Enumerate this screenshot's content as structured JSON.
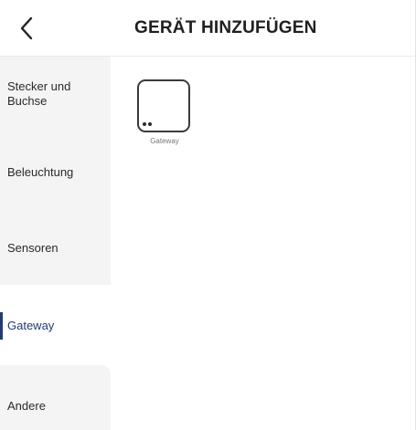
{
  "header": {
    "back_icon": "chevron-left-icon",
    "title": "GERÄT HINZUFÜGEN"
  },
  "sidebar": {
    "items": [
      {
        "label": "Stecker und\nBuchse",
        "active": false
      },
      {
        "label": "Beleuchtung",
        "active": false
      },
      {
        "label": "Sensoren",
        "active": false
      },
      {
        "label": "Gateway",
        "active": true
      },
      {
        "label": "Andere",
        "active": false
      }
    ]
  },
  "devices": [
    {
      "label": "Gateway",
      "icon": "gateway-device-icon"
    }
  ],
  "colors": {
    "accent": "#223a73",
    "sidebar_bg": "#f4f4f4",
    "text": "#222222"
  }
}
